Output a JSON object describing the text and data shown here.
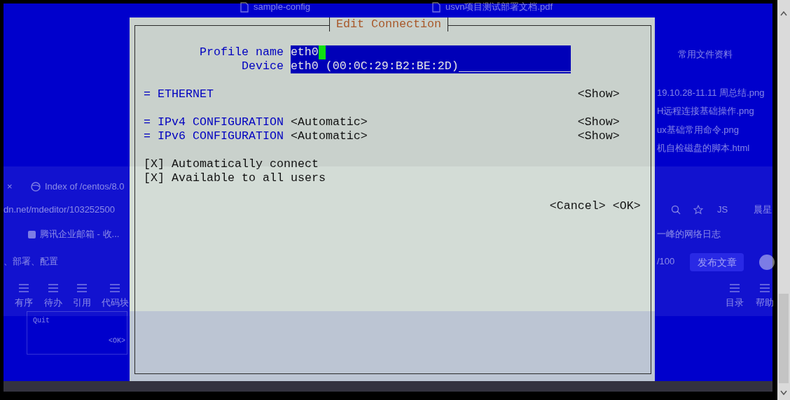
{
  "window": {
    "title": "Edit Connection"
  },
  "fields": [
    {
      "label": "Profile name",
      "value": "eth0",
      "focused": true
    },
    {
      "label": "Device",
      "value": "eth0 (00:0C:29:B2:BE:2D)",
      "focused": false
    }
  ],
  "section_groups": [
    {
      "sections": [
        {
          "title": "= ETHERNET",
          "toggle": "<Show>"
        }
      ]
    },
    {
      "sections": [
        {
          "title": "= IPv4 CONFIGURATION",
          "mode": "<Automatic>",
          "toggle": "<Show>"
        },
        {
          "title": "= IPv6 CONFIGURATION",
          "mode": "<Automatic>",
          "toggle": "<Show>"
        }
      ]
    }
  ],
  "options": [
    {
      "box": "[X]",
      "label": "Automatically connect",
      "checked": true
    },
    {
      "box": "[X]",
      "label": "Available to all users",
      "checked": true
    }
  ],
  "buttons": [
    {
      "label": "<Cancel>"
    },
    {
      "label": "<OK>"
    }
  ],
  "behind": {
    "files_top": [
      "sample-config",
      "usvn项目测试部署文档.pdf"
    ],
    "recent_title": "常用文件资料",
    "recent_files": [
      "19.10.28-11.11 周总结.png",
      "H远程连接基础操作.png",
      "ux基础常用命令.png",
      "机自检磁盘的脚本.html"
    ],
    "tab_close": "×",
    "tab": "Index of /centos/8.0",
    "address": "dn.net/mdeditor/103252500",
    "extension": "JS",
    "profile": "晨星",
    "bookmarks": [
      "腾讯企业邮箱 - 收...",
      "一峰的网络日志"
    ],
    "editor_title": "、部署、配置",
    "word_count": "/100",
    "publish": "发布文章",
    "toolbar_left": [
      "有序",
      "待办",
      "引用",
      "代码块"
    ],
    "toolbar_right": [
      "目录",
      "帮助"
    ],
    "term_left": [
      "Quit",
      "<OK>"
    ]
  }
}
